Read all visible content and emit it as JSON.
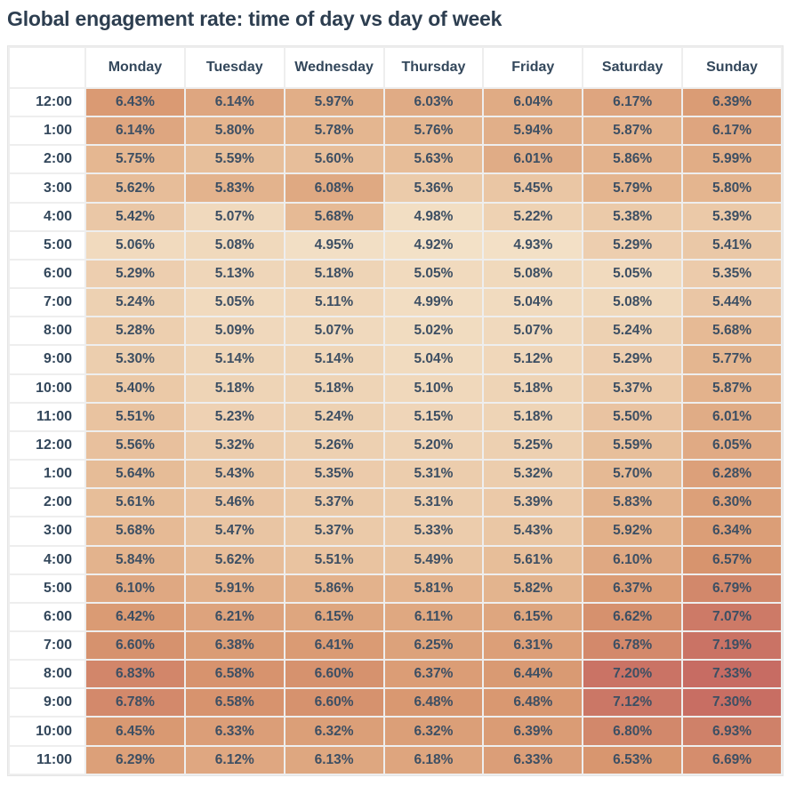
{
  "chart_data": {
    "type": "heatmap",
    "title": "Global engagement rate: time of day vs day of week",
    "xlabel": "",
    "ylabel": "",
    "columns": [
      "Monday",
      "Tuesday",
      "Wednesday",
      "Thursday",
      "Friday",
      "Saturday",
      "Sunday"
    ],
    "rows": [
      "12:00",
      "1:00",
      "2:00",
      "3:00",
      "4:00",
      "5:00",
      "6:00",
      "7:00",
      "8:00",
      "9:00",
      "10:00",
      "11:00",
      "12:00",
      "1:00",
      "2:00",
      "3:00",
      "4:00",
      "5:00",
      "6:00",
      "7:00",
      "8:00",
      "9:00",
      "10:00",
      "11:00"
    ],
    "value_format": "percent",
    "values": [
      [
        6.43,
        6.14,
        5.97,
        6.03,
        6.04,
        6.17,
        6.39
      ],
      [
        6.14,
        5.8,
        5.78,
        5.76,
        5.94,
        5.87,
        6.17
      ],
      [
        5.75,
        5.59,
        5.6,
        5.63,
        6.01,
        5.86,
        5.99
      ],
      [
        5.62,
        5.83,
        6.08,
        5.36,
        5.45,
        5.79,
        5.8
      ],
      [
        5.42,
        5.07,
        5.68,
        4.98,
        5.22,
        5.38,
        5.39
      ],
      [
        5.06,
        5.08,
        4.95,
        4.92,
        4.93,
        5.29,
        5.41
      ],
      [
        5.29,
        5.13,
        5.18,
        5.05,
        5.08,
        5.05,
        5.35
      ],
      [
        5.24,
        5.05,
        5.11,
        4.99,
        5.04,
        5.08,
        5.44
      ],
      [
        5.28,
        5.09,
        5.07,
        5.02,
        5.07,
        5.24,
        5.68
      ],
      [
        5.3,
        5.14,
        5.14,
        5.04,
        5.12,
        5.29,
        5.77
      ],
      [
        5.4,
        5.18,
        5.18,
        5.1,
        5.18,
        5.37,
        5.87
      ],
      [
        5.51,
        5.23,
        5.24,
        5.15,
        5.18,
        5.5,
        6.01
      ],
      [
        5.56,
        5.32,
        5.26,
        5.2,
        5.25,
        5.59,
        6.05
      ],
      [
        5.64,
        5.43,
        5.35,
        5.31,
        5.32,
        5.7,
        6.28
      ],
      [
        5.61,
        5.46,
        5.37,
        5.31,
        5.39,
        5.83,
        6.3
      ],
      [
        5.68,
        5.47,
        5.37,
        5.33,
        5.43,
        5.92,
        6.34
      ],
      [
        5.84,
        5.62,
        5.51,
        5.49,
        5.61,
        6.1,
        6.57
      ],
      [
        6.1,
        5.91,
        5.86,
        5.81,
        5.82,
        6.37,
        6.79
      ],
      [
        6.42,
        6.21,
        6.15,
        6.11,
        6.15,
        6.62,
        7.07
      ],
      [
        6.6,
        6.38,
        6.41,
        6.25,
        6.31,
        6.78,
        7.19
      ],
      [
        6.83,
        6.58,
        6.6,
        6.37,
        6.44,
        7.2,
        7.33
      ],
      [
        6.78,
        6.58,
        6.6,
        6.48,
        6.48,
        7.12,
        7.3
      ],
      [
        6.45,
        6.33,
        6.32,
        6.32,
        6.39,
        6.8,
        6.93
      ],
      [
        6.29,
        6.12,
        6.13,
        6.18,
        6.33,
        6.53,
        6.69
      ]
    ],
    "color_scale": {
      "min_value": 4.92,
      "max_value": 7.33,
      "stops": [
        "#f3e1c7",
        "#e5b892",
        "#d8966f",
        "#c76c63"
      ]
    },
    "legend": "none",
    "grid": true
  }
}
